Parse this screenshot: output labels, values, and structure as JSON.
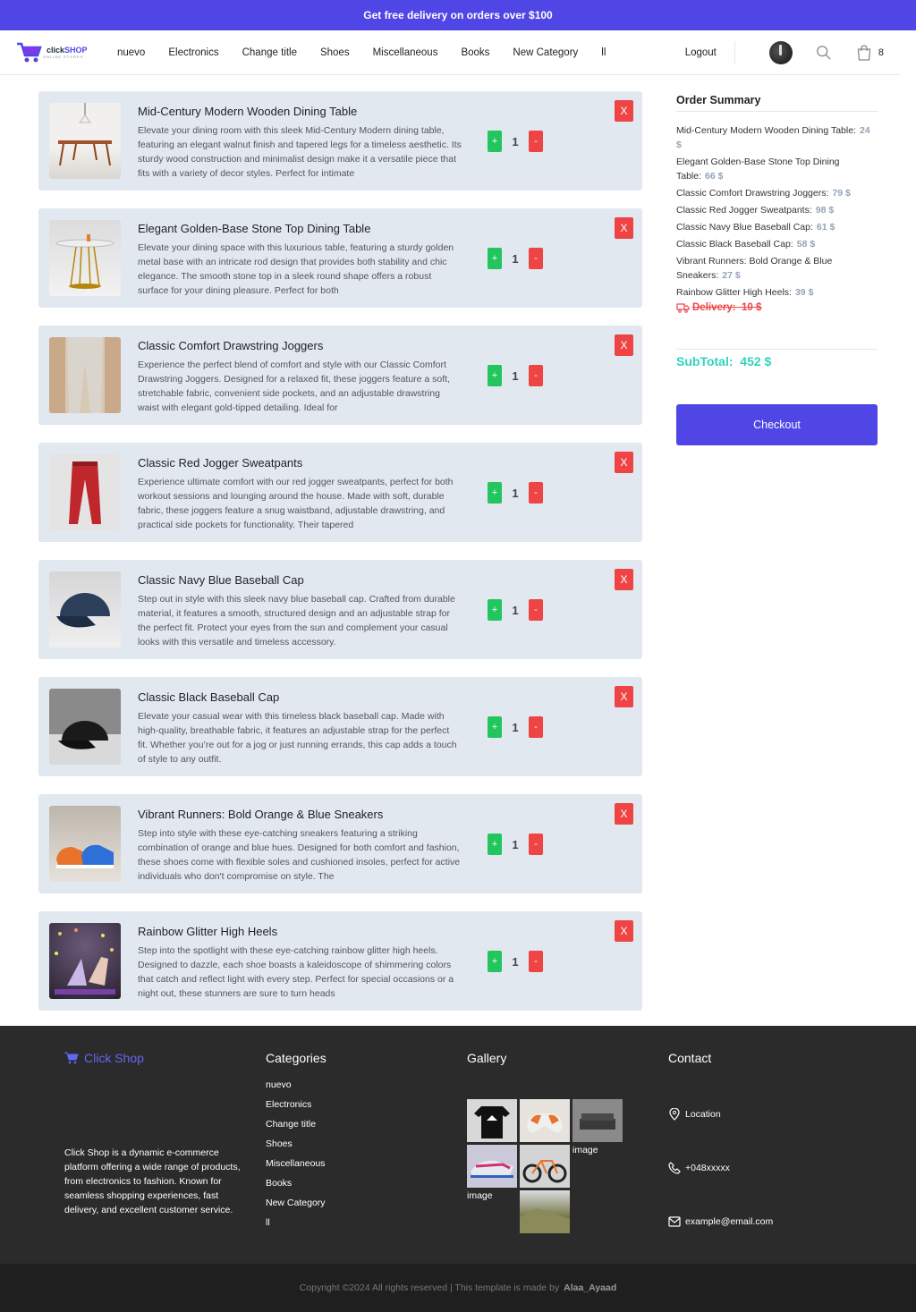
{
  "promo_bar": "Get free delivery on orders over $100",
  "logo": {
    "brand": "click",
    "brand_accent": "SHOP",
    "sub": "ONLINE STORES"
  },
  "nav": {
    "items": [
      "nuevo",
      "Electronics",
      "Change title",
      "Shoes",
      "Miscellaneous",
      "Books",
      "New Category",
      "ll"
    ],
    "logout": "Logout",
    "cart_count": "8"
  },
  "cart": {
    "items": [
      {
        "title": "Mid-Century Modern Wooden Dining Table",
        "desc": "Elevate your dining room with this sleek Mid-Century Modern dining table, featuring an elegant walnut finish and tapered legs for a timeless aesthetic. Its sturdy wood construction and minimalist design make it a versatile piece that fits with a variety of decor styles. Perfect for intimate",
        "qty": "1",
        "plus": "+",
        "minus": "-",
        "remove": "X"
      },
      {
        "title": "Elegant Golden-Base Stone Top Dining Table",
        "desc": "Elevate your dining space with this luxurious table, featuring a sturdy golden metal base with an intricate rod design that provides both stability and chic elegance. The smooth stone top in a sleek round shape offers a robust surface for your dining pleasure. Perfect for both",
        "qty": "1",
        "plus": "+",
        "minus": "-",
        "remove": "X"
      },
      {
        "title": "Classic Comfort Drawstring Joggers",
        "desc": "Experience the perfect blend of comfort and style with our Classic Comfort Drawstring Joggers. Designed for a relaxed fit, these joggers feature a soft, stretchable fabric, convenient side pockets, and an adjustable drawstring waist with elegant gold-tipped detailing. Ideal for",
        "qty": "1",
        "plus": "+",
        "minus": "-",
        "remove": "X"
      },
      {
        "title": "Classic Red Jogger Sweatpants",
        "desc": "Experience ultimate comfort with our red jogger sweatpants, perfect for both workout sessions and lounging around the house. Made with soft, durable fabric, these joggers feature a snug waistband, adjustable drawstring, and practical side pockets for functionality. Their tapered",
        "qty": "1",
        "plus": "+",
        "minus": "-",
        "remove": "X"
      },
      {
        "title": "Classic Navy Blue Baseball Cap",
        "desc": "Step out in style with this sleek navy blue baseball cap. Crafted from durable material, it features a smooth, structured design and an adjustable strap for the perfect fit. Protect your eyes from the sun and complement your casual looks with this versatile and timeless accessory.",
        "qty": "1",
        "plus": "+",
        "minus": "-",
        "remove": "X"
      },
      {
        "title": "Classic Black Baseball Cap",
        "desc": "Elevate your casual wear with this timeless black baseball cap. Made with high-quality, breathable fabric, it features an adjustable strap for the perfect fit. Whether you’re out for a jog or just running errands, this cap adds a touch of style to any outfit.",
        "qty": "1",
        "plus": "+",
        "minus": "-",
        "remove": "X"
      },
      {
        "title": "Vibrant Runners: Bold Orange & Blue Sneakers",
        "desc": "Step into style with these eye-catching sneakers featuring a striking combination of orange and blue hues. Designed for both comfort and fashion, these shoes come with flexible soles and cushioned insoles, perfect for active individuals who don't compromise on style. The",
        "qty": "1",
        "plus": "+",
        "minus": "-",
        "remove": "X"
      },
      {
        "title": "Rainbow Glitter High Heels",
        "desc": "Step into the spotlight with these eye-catching rainbow glitter high heels. Designed to dazzle, each shoe boasts a kaleidoscope of shimmering colors that catch and reflect light with every step. Perfect for special occasions or a night out, these stunners are sure to turn heads",
        "qty": "1",
        "plus": "+",
        "minus": "-",
        "remove": "X"
      }
    ]
  },
  "summary": {
    "title": "Order Summary",
    "rows": [
      {
        "name": "Mid-Century Modern Wooden Dining Table:",
        "price": "24 $"
      },
      {
        "name": "Elegant Golden-Base Stone Top Dining Table:",
        "price": "66 $"
      },
      {
        "name": "Classic Comfort Drawstring Joggers:",
        "price": "79 $"
      },
      {
        "name": "Classic Red Jogger Sweatpants:",
        "price": "98 $"
      },
      {
        "name": "Classic Navy Blue Baseball Cap:",
        "price": "61 $"
      },
      {
        "name": "Classic Black Baseball Cap:",
        "price": "58 $"
      },
      {
        "name": "Vibrant Runners: Bold Orange & Blue Sneakers:",
        "price": "27 $"
      },
      {
        "name": "Rainbow Glitter High Heels:",
        "price": "39 $"
      }
    ],
    "delivery_label": "Delivery:",
    "delivery_price": "10 $",
    "subtotal_label": "SubTotal:",
    "subtotal_value": "452 $",
    "checkout": "Checkout"
  },
  "footer": {
    "brand": "Click Shop",
    "description": "Click Shop is a dynamic e-commerce platform offering a wide range of products, from electronics to fashion. Known for seamless shopping experiences, fast delivery, and excellent customer service.",
    "categories_title": "Categories",
    "categories": [
      "nuevo",
      "Electronics",
      "Change title",
      "Shoes",
      "Miscellaneous",
      "Books",
      "New Category",
      "ll"
    ],
    "gallery_title": "Gallery",
    "gallery_alt": "image",
    "contact_title": "Contact",
    "location": "Location",
    "phone": "+048xxxxx",
    "email": "example@email.com"
  },
  "copyright": {
    "text": "Copyright ©2024 All rights reserved | This template is made by",
    "author": "Alaa_Ayaad"
  },
  "colors": {
    "primary": "#4f46e5",
    "plus": "#22c55e",
    "minus": "#ef4444",
    "subtotal": "#2dd4bf",
    "card": "#e2e8f0",
    "footer": "#2b2b2b"
  }
}
